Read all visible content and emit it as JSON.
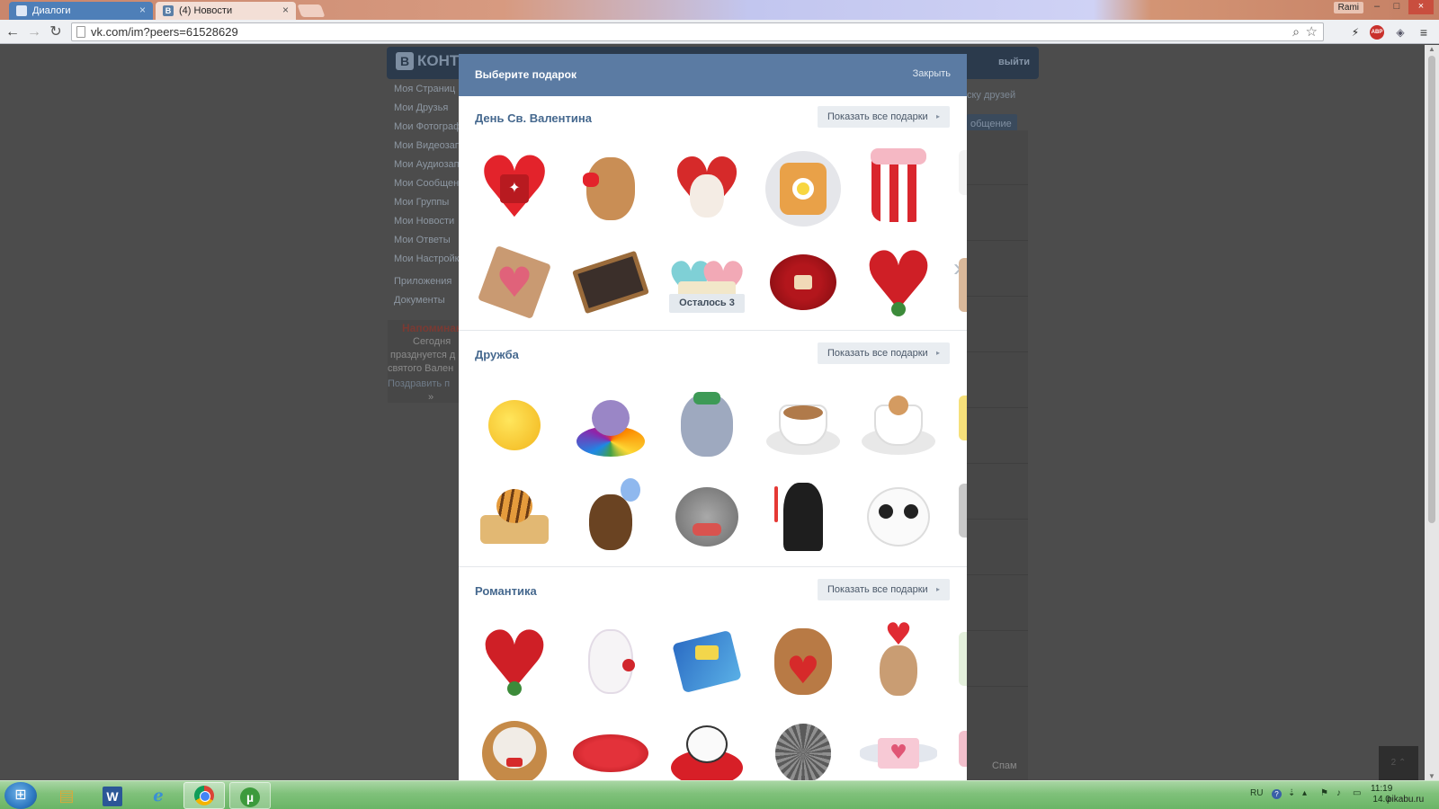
{
  "browser": {
    "tabs": [
      {
        "label": "Диалоги",
        "close": "×"
      },
      {
        "label": "(4) Новости",
        "favicon": "В",
        "close": "×"
      }
    ],
    "user": "Rami",
    "window_buttons": {
      "minimize": "–",
      "maximize": "□",
      "close": "×"
    },
    "url": "vk.com/im?peers=61528629",
    "extensions": {
      "abp": "ABP"
    },
    "icons": [
      "back-arrow-icon",
      "forward-arrow-icon",
      "reload-icon",
      "page-icon",
      "zoom-icon",
      "star-icon",
      "lightning-icon",
      "adblock-icon",
      "shield-icon",
      "menu-icon"
    ]
  },
  "vk": {
    "logo_letter": "В",
    "logo_text": "КОНТ",
    "header_right": {
      "help": "ь",
      "logout": "выйти"
    },
    "left_menu": [
      "Моя Страниц",
      "Мои Друзья",
      "Мои Фотограф",
      "Мои Видеозап",
      "Мои Аудиозап",
      "Мои Сообщен",
      "Мои Группы",
      "Мои Новости",
      "Мои Ответы",
      "Мои Настройк"
    ],
    "left_menu_extra": [
      "Приложения",
      "Документы"
    ],
    "reminder": {
      "title": "Напоминан",
      "lines": [
        "Сегодня",
        "празднуется д",
        "святого Вален"
      ],
      "link": "Поздравить п",
      "more": "»"
    },
    "right": {
      "friends_text": "ску друзей",
      "message_button": "общение",
      "spam": "Спам"
    },
    "corner_box": "2 ⌃"
  },
  "modal": {
    "title": "Выберите подарок",
    "close": "Закрыть",
    "show_all_label": "Показать все подарки",
    "arrow": "▸",
    "next": "›",
    "sections": [
      {
        "title": "День Св. Валентина",
        "badge": "Осталось 3"
      },
      {
        "title": "Дружба"
      },
      {
        "title": "Романтика"
      }
    ],
    "gift_icons": {
      "valentine": [
        "heart-icon",
        "teddy-bear-icon",
        "puppy-heart-icon",
        "toast-egg-icon",
        "popcorn-bucket-icon",
        "heart-envelope-icon",
        "chalkboard-icon",
        "valentines-balloons-icon",
        "rose-bouquet-icon",
        "heart-roses-icon"
      ],
      "friendship": [
        "chick-icon",
        "hippo-pool-icon",
        "elephant-icon",
        "coffee-cup-icon",
        "latte-cup-icon",
        "tiger-cub-icon",
        "bear-balloon-icon",
        "cat-fish-icon",
        "darth-vader-icon",
        "panda-icon"
      ],
      "romance": [
        "heart-roses-icon",
        "white-kitten-icon",
        "love-is-gum-icon",
        "bear-heart-icon",
        "bunny-love-icon",
        "bear-basket-icon",
        "kiss-lips-icon",
        "panda-heart-icon",
        "hedgehog-icon",
        "winged-envelope-icon"
      ]
    }
  },
  "taskbar": {
    "apps": [
      "start-icon",
      "explorer-icon",
      "word-icon",
      "ie-icon",
      "chrome-icon",
      "utorrent-icon"
    ],
    "word_letter": "W",
    "utorrent_letter": "µ",
    "tray": {
      "lang": "RU",
      "help": "?"
    },
    "clock": {
      "time": "11:19",
      "date": "14.0"
    },
    "watermark": "pikabu.ru"
  },
  "colors": {
    "vk_header": "#5b7ba3",
    "vk_link": "#45688e",
    "button_bg": "#e9edf1"
  }
}
